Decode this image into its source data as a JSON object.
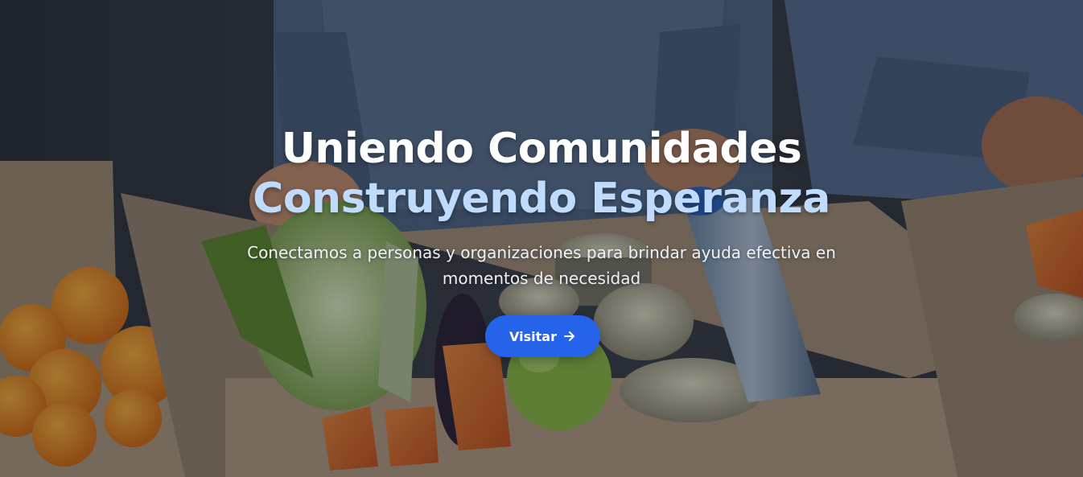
{
  "hero": {
    "title_line_1": "Uniendo Comunidades",
    "title_line_2": "Construyendo Esperanza",
    "subtitle": "Conectamos a personas y organizaciones para brindar ayuda efectiva en momentos de necesidad",
    "cta_label": "Visitar",
    "cta_icon": "arrow-right-icon",
    "background_image": "donation-box-with-vegetables-and-canned-food",
    "colors": {
      "title_primary": "#ffffff",
      "title_accent": "#bfdbfe",
      "cta_background": "#2563eb"
    }
  }
}
